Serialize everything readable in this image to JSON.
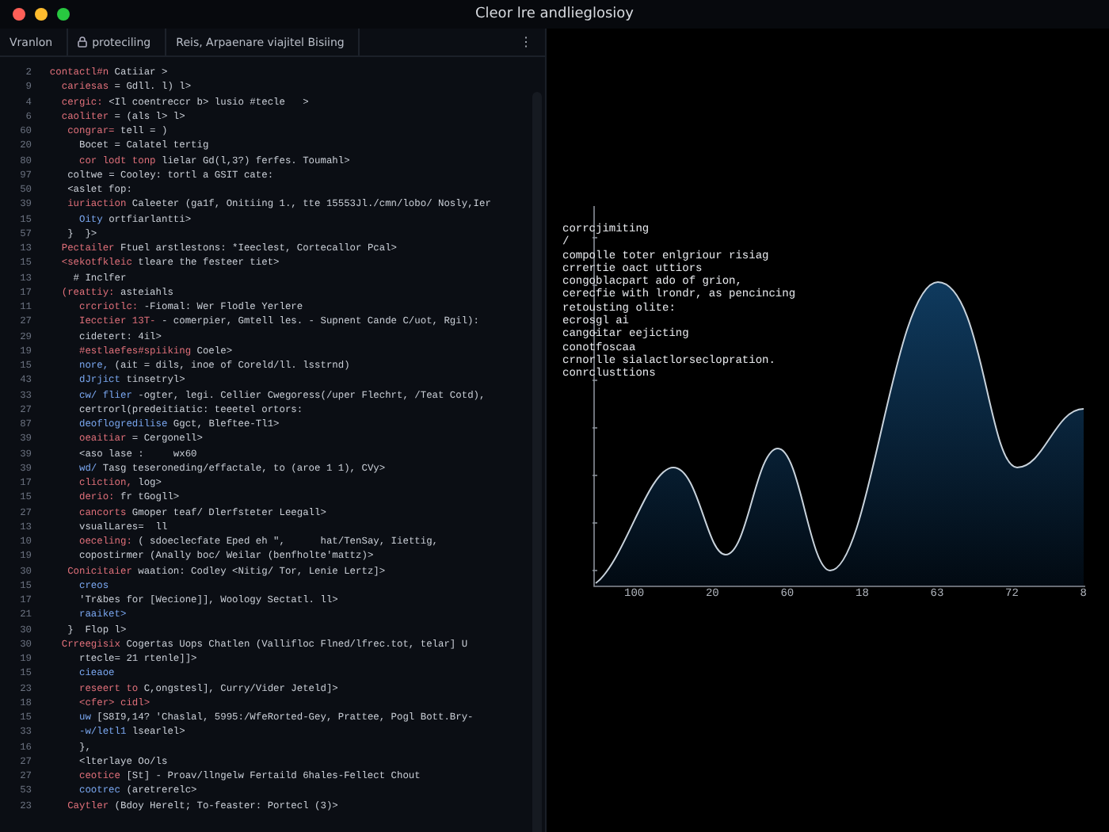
{
  "window": {
    "title": "Cleor lre andlieglosioy"
  },
  "tabs": [
    {
      "label": "Vranlon",
      "icon": false
    },
    {
      "label": "proteciling",
      "icon": true
    },
    {
      "label": "Reis, Arpaenare viajitel Bisiing",
      "icon": false
    }
  ],
  "tab_menu": "⋮",
  "code_lines": [
    {
      "num": "2",
      "kw": "  contactl#n",
      "kind": "keyword",
      "rest": " Catiiar >"
    },
    {
      "num": "9",
      "kw": "    cariesas",
      "kind": "keyword",
      "rest": " = Gdll. l) l>"
    },
    {
      "num": "4",
      "kw": "    cergic:",
      "kind": "keyword",
      "rest": " <Il coentreccr b> lusio #tecle   >"
    },
    {
      "num": "6",
      "kw": "    caoliter",
      "kind": "keyword",
      "rest": " = (als l> l>"
    },
    {
      "num": "60",
      "kw": "     congrar=",
      "kind": "keyword",
      "rest": " tell = )"
    },
    {
      "num": "20",
      "kw": "       Bocet",
      "kind": "plain",
      "rest": " = Calatel tertig"
    },
    {
      "num": "80",
      "kw": "       cor lodt tonp",
      "kind": "keyword",
      "rest": " lielar Gd(l,3?) ferfes. Toumahl>"
    },
    {
      "num": "97",
      "kw": "     coltwe",
      "kind": "plain",
      "rest": " = Cooley: tortl a GSIT cate:"
    },
    {
      "num": "50",
      "kw": "     <aslet fop:",
      "kind": "plain"
    },
    {
      "num": "39",
      "kw": "     iuriaction",
      "kind": "keyword",
      "rest": " Caleeter (ga1f, Onitiing 1., tte 15553Jl./cmn/lobo/ Nosly,Ier"
    },
    {
      "num": "15",
      "kw": "       Oity",
      "kind": "type",
      "rest": " ortfiarlantti>"
    },
    {
      "num": "57",
      "kw": "     }",
      "kind": "plain",
      "rest": "  }>"
    },
    {
      "num": "13",
      "kw": "    Pectailer",
      "kind": "keyword",
      "rest": " Ftuel arstlestons: *Ieeclest, Cortecallor Pcal>"
    },
    {
      "num": "15",
      "kw": "    <sekotfkleic",
      "kind": "keyword",
      "rest": " tleare the festeer tiet>"
    },
    {
      "num": "13",
      "kw": "      # Inclfer",
      "kind": "plain"
    },
    {
      "num": "17",
      "kw": "    (reattiy:",
      "kind": "keyword",
      "rest": " asteiahls"
    },
    {
      "num": "11",
      "kw": "       crcriotlc:",
      "kind": "keyword",
      "rest": " -Fiomal: Wer Flodle Yerlere"
    },
    {
      "num": "27",
      "kw": "       Iecctier 13T-",
      "kind": "keyword",
      "rest": " - comerpier, Gmtell les. - Supnent Cande C/uot, Rgil):"
    },
    {
      "num": "29",
      "kw": "       cidetert:",
      "kind": "plain",
      "rest": " 4il>"
    },
    {
      "num": "19",
      "kw": "       #estlaefes#spiiking",
      "kind": "keyword",
      "rest": " Coele>"
    },
    {
      "num": "15",
      "kw": "       nore,",
      "kind": "type",
      "rest": " (ait = dils, inoe of Coreld/ll. lsstrnd)"
    },
    {
      "num": "43",
      "kw": "       dJrjict",
      "kind": "type",
      "rest": " tinsetryl>"
    },
    {
      "num": "33",
      "kw": "       cw/ flier",
      "kind": "type",
      "rest": " -ogter, legi. Cellier Cwegoress(/uper Flechrt, /Teat Cotd),"
    },
    {
      "num": "27",
      "kw": "       certrorl(predeitiatic:",
      "kind": "plain",
      "rest": " teeetel ortors:"
    },
    {
      "num": "87",
      "kw": "       deoflogredilise",
      "kind": "type",
      "rest": " Ggct, Bleftee-Tl1>"
    },
    {
      "num": "39",
      "kw": "       oeaitiar",
      "kind": "keyword",
      "rest": " = Cergonell>"
    },
    {
      "num": "39",
      "kw": "       <aso lase :",
      "kind": "plain",
      "rest": "     wx60"
    },
    {
      "num": "39",
      "kw": "       wd/",
      "kind": "type",
      "rest": " Tasg teseroneding/effactale, to (aroe 1 1), CVy>"
    },
    {
      "num": "17",
      "kw": "       cliction,",
      "kind": "keyword",
      "rest": " log>"
    },
    {
      "num": "15",
      "kw": "       derio:",
      "kind": "keyword",
      "rest": " fr tGogll>"
    },
    {
      "num": "27",
      "kw": "       cancorts",
      "kind": "keyword",
      "rest": " Gmoper teaf/ Dlerfsteter Leegall>"
    },
    {
      "num": "13",
      "kw": "       vsualLares=",
      "kind": "plain",
      "rest": "  ll"
    },
    {
      "num": "10",
      "kw": "       oeceling:",
      "kind": "keyword",
      "rest": " ( sdoeclecfate Eped eh \",      hat/TenSay, Iiettig,"
    },
    {
      "num": "19",
      "kw": "       copostirmer",
      "kind": "plain",
      "rest": " (Anally boc/ Weilar (benfholte'mattz)>"
    },
    {
      "num": "30",
      "kw": "     Conicitaier",
      "kind": "keyword",
      "rest": " waation: Codley <Nitig/ Tor, Lenie Lertz]>"
    },
    {
      "num": "15",
      "kw": "       creos",
      "kind": "type"
    },
    {
      "num": "17",
      "kw": "       'Tr&bes",
      "kind": "plain",
      "rest": " for [Wecione]], Woology Sectatl. ll>"
    },
    {
      "num": "21",
      "kw": "       raaiket>",
      "kind": "type"
    },
    {
      "num": "30",
      "kw": "     }",
      "kind": "plain",
      "rest": "  Flop l>"
    },
    {
      "num": "30",
      "kw": "    Crreegisix",
      "kind": "keyword",
      "rest": " Cogertas Uops Chatlen (Vallifloc Flned/lfrec.tot, telar] U"
    },
    {
      "num": "19",
      "kw": "       rtecle=",
      "kind": "plain",
      "rest": " 21 rtenle]]>"
    },
    {
      "num": "15",
      "kw": "       cieaoe",
      "kind": "type"
    },
    {
      "num": "23",
      "kw": "       reseert to",
      "kind": "keyword",
      "rest": " C,ongstesl], Curry/Vider Jeteld]>"
    },
    {
      "num": "18",
      "kw": "       <cfer> cidl>",
      "kind": "keyword"
    },
    {
      "num": "15",
      "kw": "       uw",
      "kind": "type",
      "rest": " [S8I9,14? 'Chaslal, 5995:/WfeRorted-Gey, Prattee, Pogl Bott.Bry-"
    },
    {
      "num": "33",
      "kw": "       -w/letl1",
      "kind": "type",
      "rest": " lsearlel>"
    },
    {
      "num": "16",
      "kw": "       },",
      "kind": "plain"
    },
    {
      "num": "27",
      "kw": "       <lterlaye",
      "kind": "plain",
      "rest": " Oo/ls"
    },
    {
      "num": "27",
      "kw": "       ceotice",
      "kind": "keyword",
      "rest": " [St] - Proav/llngelw Fertaild 6hales-Fellect Chout"
    },
    {
      "num": "53",
      "kw": "       cootrec",
      "kind": "type",
      "rest": " (aretrerelc>"
    },
    {
      "num": "23",
      "kw": "     Caytler",
      "kind": "keyword",
      "rest": " (Bdoy Herelt; To-feaster: Portecl (3)>"
    }
  ],
  "chart": {
    "notes": [
      "corrcjimiting",
      "/",
      "compolle toter enlgriour risiag",
      "crrertie oact uttiors",
      "congoblacpart ado of grion,",
      "cerecfie with lrondr, as pencincing",
      "retousting olite:",
      "ecrosgl ai",
      "cangoitar eejicting",
      "conotfoscaa",
      "crnorlle sialactlorseclopration.",
      "conrclusttions"
    ],
    "x_labels": [
      "100",
      "20",
      "60",
      "18",
      "63",
      "72",
      "8"
    ]
  }
}
